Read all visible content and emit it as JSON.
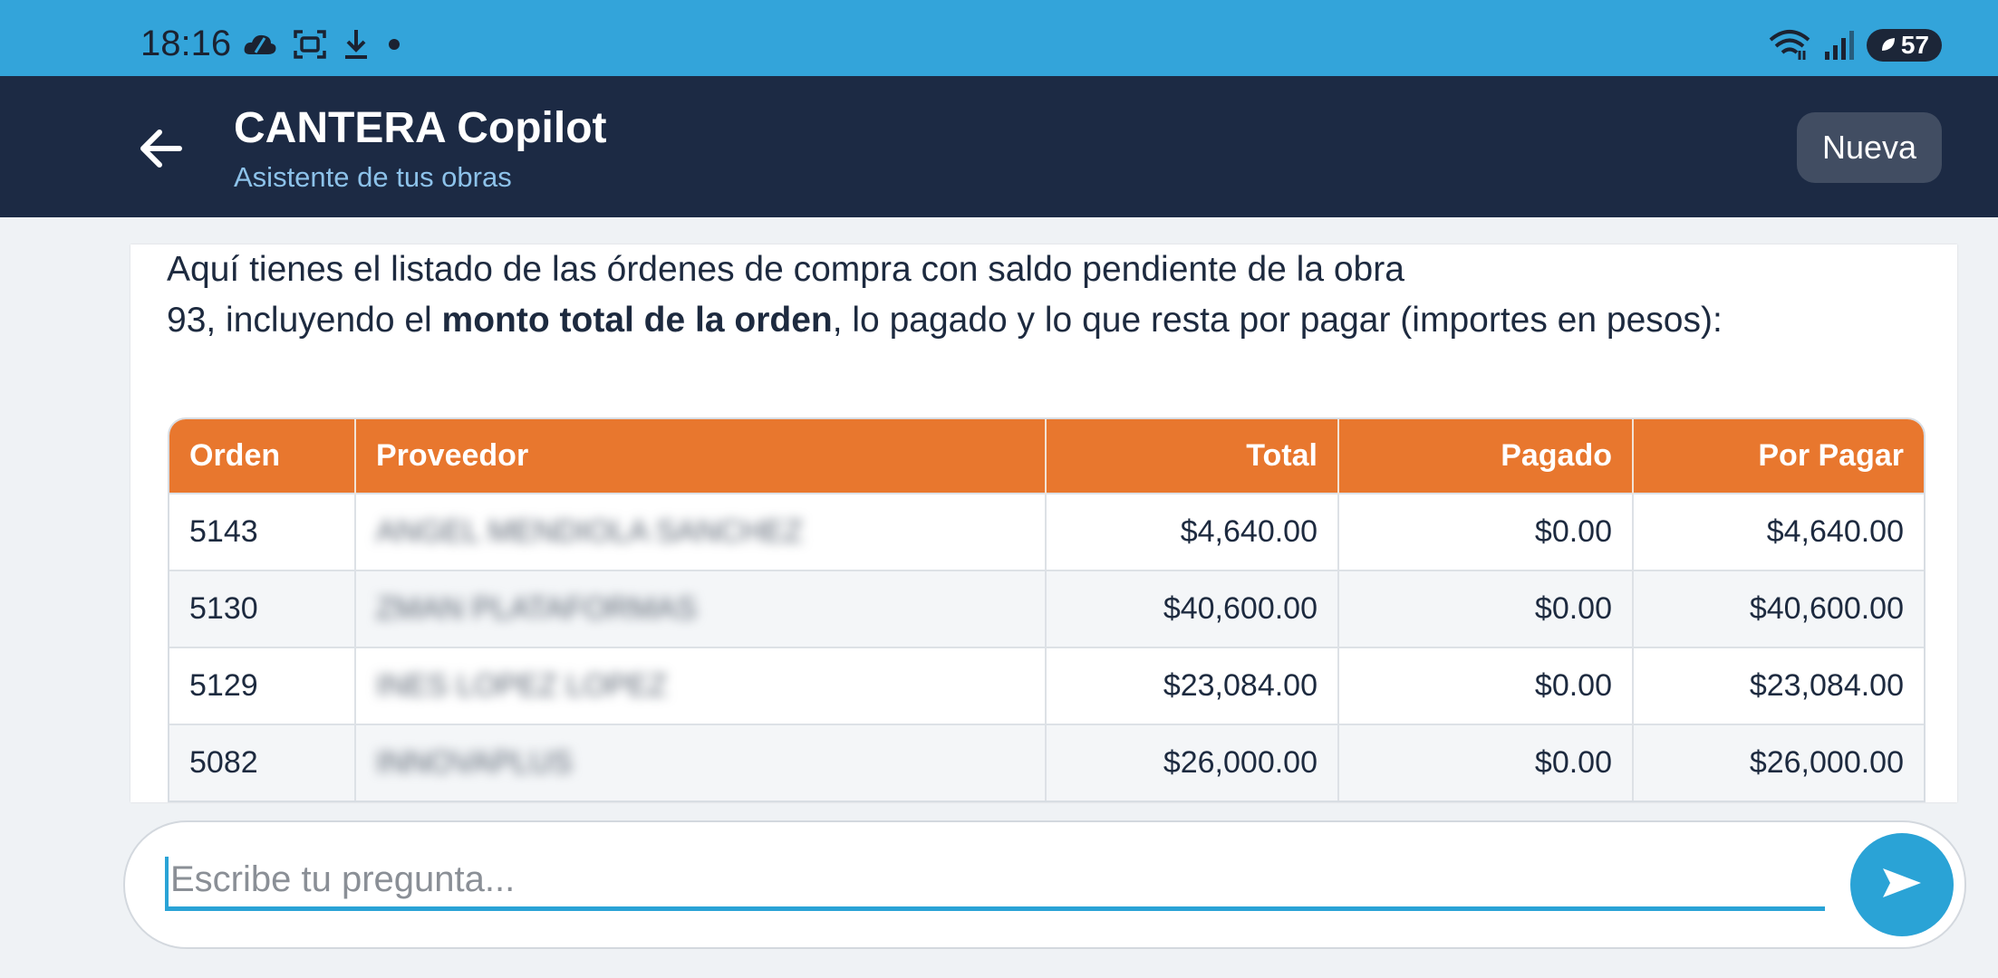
{
  "status_bar": {
    "time": "18:16",
    "battery": "57",
    "left_icons": [
      "cloud-icon",
      "screenshot-icon",
      "download-icon",
      "dot-icon"
    ],
    "right_icons": [
      "wifi-icon",
      "signal-icon",
      "battery-icon"
    ]
  },
  "app_bar": {
    "title": "CANTERA Copilot",
    "subtitle": "Asistente de tus obras",
    "new_button": "Nueva"
  },
  "message": {
    "line1": "Aquí tienes el listado de las órdenes de compra con saldo pendiente de la obra",
    "line2_prefix": "93, incluyendo el ",
    "line2_bold": "monto total de la orden",
    "line2_suffix": ", lo pagado y lo que resta por pagar (importes en pesos):"
  },
  "table": {
    "headers": [
      "Orden",
      "Proveedor",
      "Total",
      "Pagado",
      "Por Pagar"
    ],
    "rows": [
      {
        "orden": "5143",
        "proveedor": "ANGEL MENDIOLA SANCHEZ",
        "total": "$4,640.00",
        "pagado": "$0.00",
        "por_pagar": "$4,640.00"
      },
      {
        "orden": "5130",
        "proveedor": "ZMAN PLATAFORMAS",
        "total": "$40,600.00",
        "pagado": "$0.00",
        "por_pagar": "$40,600.00"
      },
      {
        "orden": "5129",
        "proveedor": "INES LOPEZ LOPEZ",
        "total": "$23,084.00",
        "pagado": "$0.00",
        "por_pagar": "$23,084.00"
      },
      {
        "orden": "5082",
        "proveedor": "INNOVAPLUS",
        "total": "$26,000.00",
        "pagado": "$0.00",
        "por_pagar": "$26,000.00"
      }
    ]
  },
  "input": {
    "placeholder": "Escribe tu pregunta..."
  },
  "colors": {
    "status_bar": "#33a4da",
    "app_bar": "#1c2a44",
    "table_header": "#e8772e",
    "accent": "#2aa3d6"
  }
}
